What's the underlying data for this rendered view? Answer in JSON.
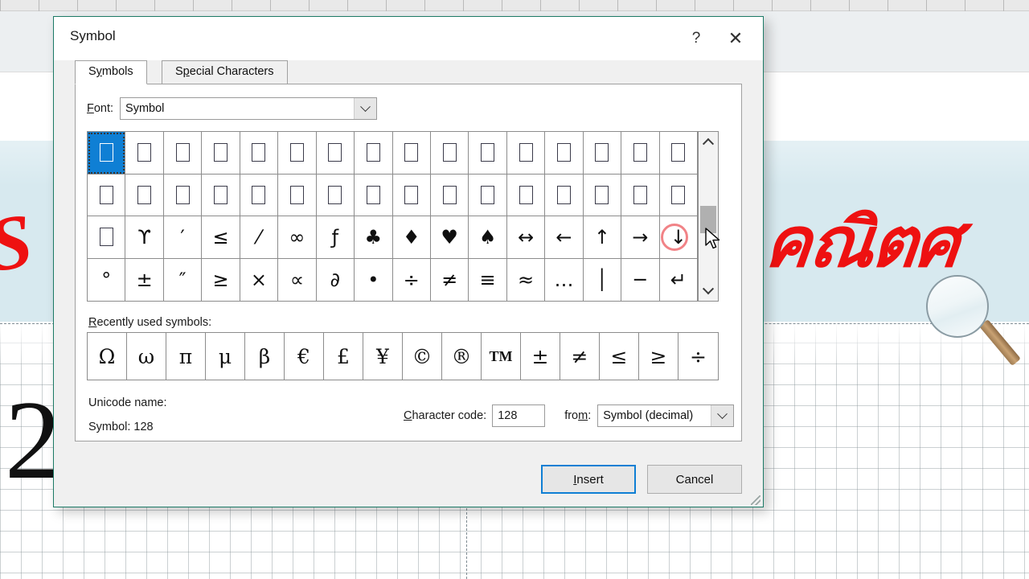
{
  "background": {
    "banner_text_thai": "คณิตศ",
    "red_letter": "S",
    "big_number": "2",
    "magnifier_icon": "magnifying-glass-icon"
  },
  "dialog": {
    "title": "Symbol",
    "help_button": "?",
    "close_button": "✕",
    "tabs": [
      {
        "label_pre": "S",
        "label_underline": "y",
        "label_post": "mbols",
        "label": "Symbols",
        "active": true
      },
      {
        "label_pre": "S",
        "label_underline": "p",
        "label_post": "ecial Characters",
        "label": "Special Characters",
        "active": false
      }
    ],
    "font": {
      "label": "Font:",
      "label_underline": "F",
      "value": "Symbol",
      "dropdown_icon": "chevron-down-icon"
    },
    "symbol_grid": {
      "columns": 16,
      "rows": 4,
      "selected_index": 0,
      "annotated_index": 47,
      "cells": [
        {
          "g": "□",
          "t": "box"
        },
        {
          "g": "□",
          "t": "box"
        },
        {
          "g": "□",
          "t": "box"
        },
        {
          "g": "□",
          "t": "box"
        },
        {
          "g": "□",
          "t": "box"
        },
        {
          "g": "□",
          "t": "box"
        },
        {
          "g": "□",
          "t": "box"
        },
        {
          "g": "□",
          "t": "box"
        },
        {
          "g": "□",
          "t": "box"
        },
        {
          "g": "□",
          "t": "box"
        },
        {
          "g": "□",
          "t": "box"
        },
        {
          "g": "□",
          "t": "box"
        },
        {
          "g": "□",
          "t": "box"
        },
        {
          "g": "□",
          "t": "box"
        },
        {
          "g": "□",
          "t": "box"
        },
        {
          "g": "□",
          "t": "box"
        },
        {
          "g": "□",
          "t": "box"
        },
        {
          "g": "□",
          "t": "box"
        },
        {
          "g": "□",
          "t": "box"
        },
        {
          "g": "□",
          "t": "box"
        },
        {
          "g": "□",
          "t": "box"
        },
        {
          "g": "□",
          "t": "box"
        },
        {
          "g": "□",
          "t": "box"
        },
        {
          "g": "□",
          "t": "box"
        },
        {
          "g": "□",
          "t": "box"
        },
        {
          "g": "□",
          "t": "box"
        },
        {
          "g": "□",
          "t": "box"
        },
        {
          "g": "□",
          "t": "box"
        },
        {
          "g": "□",
          "t": "box"
        },
        {
          "g": "□",
          "t": "box"
        },
        {
          "g": "□",
          "t": "box"
        },
        {
          "g": "□",
          "t": "box"
        },
        {
          "g": "□",
          "t": "box"
        },
        {
          "g": "ϒ",
          "t": "char"
        },
        {
          "g": "′",
          "t": "char"
        },
        {
          "g": "≤",
          "t": "char"
        },
        {
          "g": "⁄",
          "t": "char"
        },
        {
          "g": "∞",
          "t": "char"
        },
        {
          "g": "ƒ",
          "t": "char"
        },
        {
          "g": "♣",
          "t": "char"
        },
        {
          "g": "♦",
          "t": "char"
        },
        {
          "g": "♥",
          "t": "char"
        },
        {
          "g": "♠",
          "t": "char"
        },
        {
          "g": "↔",
          "t": "char"
        },
        {
          "g": "←",
          "t": "char"
        },
        {
          "g": "↑",
          "t": "char"
        },
        {
          "g": "→",
          "t": "char"
        },
        {
          "g": "↓",
          "t": "char"
        },
        {
          "g": "°",
          "t": "char"
        },
        {
          "g": "±",
          "t": "char"
        },
        {
          "g": "″",
          "t": "char"
        },
        {
          "g": "≥",
          "t": "char"
        },
        {
          "g": "×",
          "t": "char"
        },
        {
          "g": "∝",
          "t": "char"
        },
        {
          "g": "∂",
          "t": "char"
        },
        {
          "g": "•",
          "t": "char"
        },
        {
          "g": "÷",
          "t": "char"
        },
        {
          "g": "≠",
          "t": "char"
        },
        {
          "g": "≡",
          "t": "char"
        },
        {
          "g": "≈",
          "t": "char"
        },
        {
          "g": "…",
          "t": "char"
        },
        {
          "g": "│",
          "t": "char"
        },
        {
          "g": "─",
          "t": "char"
        },
        {
          "g": "↵",
          "t": "char"
        }
      ]
    },
    "scrollbar": {
      "up_icon": "chevron-up-icon",
      "down_icon": "chevron-down-icon",
      "thumb_position_percent": 45
    },
    "recent": {
      "label": "Recently used symbols:",
      "label_underline": "R",
      "symbols": [
        "Ω",
        "ω",
        "π",
        "μ",
        "β",
        "€",
        "£",
        "¥",
        "©",
        "®",
        "TM",
        "±",
        "≠",
        "≤",
        "≥",
        "÷"
      ]
    },
    "unicode_name_label": "Unicode name:",
    "unicode_name_value": "Symbol: 128",
    "character_code": {
      "label": "Character code:",
      "label_underline": "C",
      "value": "128"
    },
    "from": {
      "label": "from:",
      "label_underline": "m",
      "value": "Symbol (decimal)",
      "dropdown_icon": "chevron-down-icon"
    },
    "buttons": {
      "insert_pre": "",
      "insert_underline": "I",
      "insert_post": "nsert",
      "insert": "Insert",
      "cancel": "Cancel"
    }
  },
  "colors": {
    "dialog_border": "#1c7a66",
    "selection_blue": "#0f7fd4",
    "banner_blue": "#d7e9ef",
    "thai_red": "#ee1111",
    "annotation_red": "#ec5a5f"
  }
}
